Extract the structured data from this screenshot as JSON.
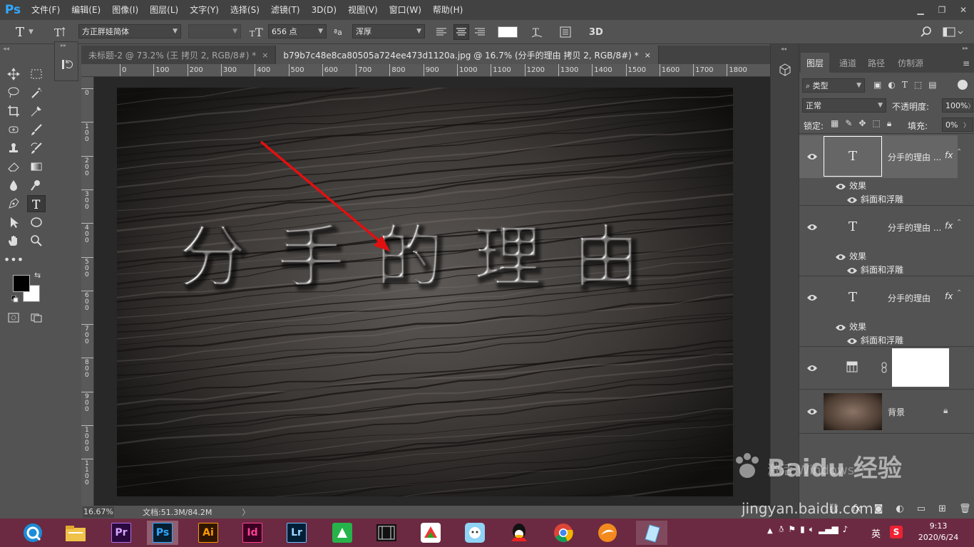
{
  "app": {
    "logo": "Ps"
  },
  "menu": [
    "文件(F)",
    "编辑(E)",
    "图像(I)",
    "图层(L)",
    "文字(Y)",
    "选择(S)",
    "滤镜(T)",
    "3D(D)",
    "视图(V)",
    "窗口(W)",
    "帮助(H)"
  ],
  "window_controls": [
    "minimize-icon",
    "restore-icon",
    "close-icon"
  ],
  "options": {
    "tool_glyph": "T",
    "font_family": "方正胖娃简体",
    "font_size": "656 点",
    "aa_label": "ªa",
    "antialias": "浑厚",
    "three_d": "3D",
    "text_color": "#ffffff"
  },
  "tabs": [
    {
      "label": "未标题-2 @ 73.2% (王 拷贝 2, RGB/8#) *",
      "active": false
    },
    {
      "label": "b79b7c48e8ca80505a724ee473d1120a.jpg @ 16.7% (分手的理由 拷贝 2, RGB/8#) *",
      "active": true
    }
  ],
  "close_glyph": "×",
  "ruler_h": [
    "0",
    "100",
    "200",
    "300",
    "400",
    "500",
    "600",
    "700",
    "800",
    "900",
    "1000",
    "1100",
    "1200",
    "1300",
    "1400",
    "1500",
    "1600",
    "1700",
    "1800"
  ],
  "ruler_v": [
    "0",
    "100",
    "200",
    "300",
    "400",
    "500",
    "600",
    "700",
    "800",
    "900",
    "1000",
    "1100"
  ],
  "canvas_text": "分手的理由",
  "status": {
    "zoom": "16.67%",
    "doc": "文档:51.3M/84.2M",
    "arrow": "〉"
  },
  "panel": {
    "tabs": [
      "图层",
      "通道",
      "路径",
      "仿制源"
    ],
    "filter_label": "类型",
    "blend_mode": "正常",
    "opacity_label": "不透明度:",
    "opacity_value": "100%",
    "lock_label": "锁定:",
    "fill_label": "填充:",
    "fill_value": "0%",
    "layers": [
      {
        "name": "分手的理由 ...",
        "effects_label": "效果",
        "effect": "斜面和浮雕",
        "selected": true
      },
      {
        "name": "分手的理由 ...",
        "effects_label": "效果",
        "effect": "斜面和浮雕",
        "selected": false
      },
      {
        "name": "分手的理由",
        "effects_label": "效果",
        "effect": "斜面和浮雕",
        "selected": false
      }
    ],
    "adjustment_layer": {
      "name": ""
    },
    "background_layer": {
      "name": "背景"
    },
    "fx": "fx"
  },
  "watermark": {
    "activate": "激活 Windows",
    "brand": "Baidu 经验",
    "url": "jingyan.baidu.com"
  },
  "taskbar": {
    "apps": [
      "Pr",
      "Ps",
      "Ai",
      "Id",
      "Lr"
    ],
    "ime": "英",
    "time": "9:13",
    "date": "2020/6/24"
  },
  "colors": {
    "arrow": "#e01010",
    "ps_blue": "#31a8ff",
    "taskbar": "#6b2a41"
  }
}
